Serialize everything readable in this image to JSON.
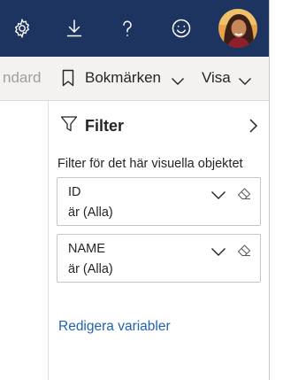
{
  "topbar": {
    "settings_icon": "gear-icon",
    "download_icon": "download-icon",
    "help_icon": "question-icon",
    "feedback_icon": "smiley-icon",
    "avatar_icon": "user-avatar",
    "background_color": "#1d3360"
  },
  "toolbar": {
    "standard_label_partial": "ndard",
    "bookmarks_label": "Bokmärken",
    "view_label": "Visa"
  },
  "filter_pane": {
    "title": "Filter",
    "section_label": "Filter för det här visuella objektet",
    "cards": [
      {
        "field": "ID",
        "value": "är (Alla)"
      },
      {
        "field": "NAME",
        "value": "är (Alla)"
      }
    ],
    "edit_link": "Redigera variabler",
    "link_color": "#2162b5"
  }
}
